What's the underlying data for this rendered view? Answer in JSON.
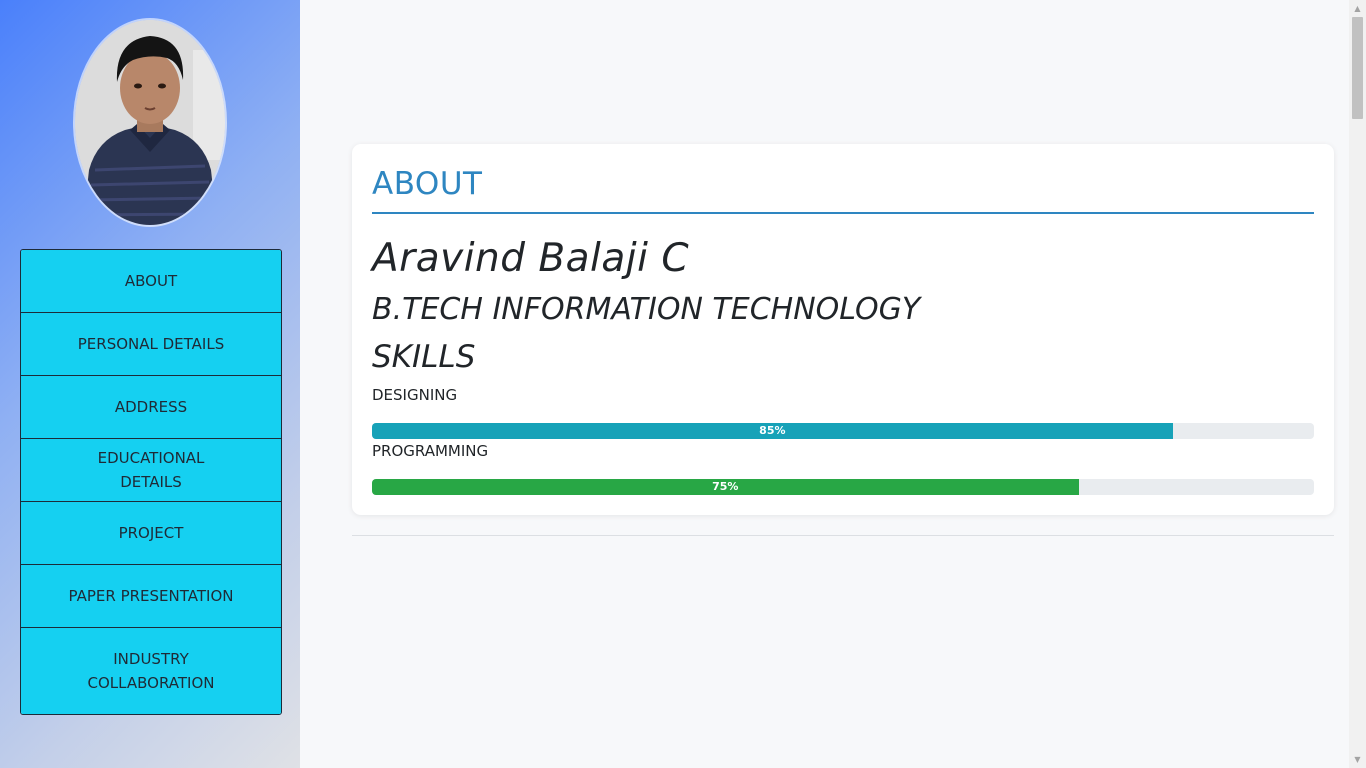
{
  "sidebar": {
    "avatar_icon": "person-photo",
    "items": [
      {
        "label": "ABOUT"
      },
      {
        "label": "PERSONAL DETAILS"
      },
      {
        "label": "ADDRESS"
      },
      {
        "label": "EDUCATIONAL DETAILS"
      },
      {
        "label": "PROJECT"
      },
      {
        "label": "PAPER PRESENTATION"
      },
      {
        "label": "INDUSTRY COLLABORATION"
      }
    ]
  },
  "about": {
    "title": "ABOUT",
    "name": "Aravind Balaji C",
    "degree": "B.TECH INFORMATION TECHNOLOGY",
    "skills_title": "SKILLS",
    "skills": [
      {
        "label": "DESIGNING",
        "percent": 85,
        "percent_text": "85%",
        "color": "#17a2b8"
      },
      {
        "label": "PROGRAMMING",
        "percent": 75,
        "percent_text": "75%",
        "color": "#28a745"
      }
    ]
  },
  "colors": {
    "accent": "#2e86c1",
    "nav_bg": "#15d0f1"
  }
}
